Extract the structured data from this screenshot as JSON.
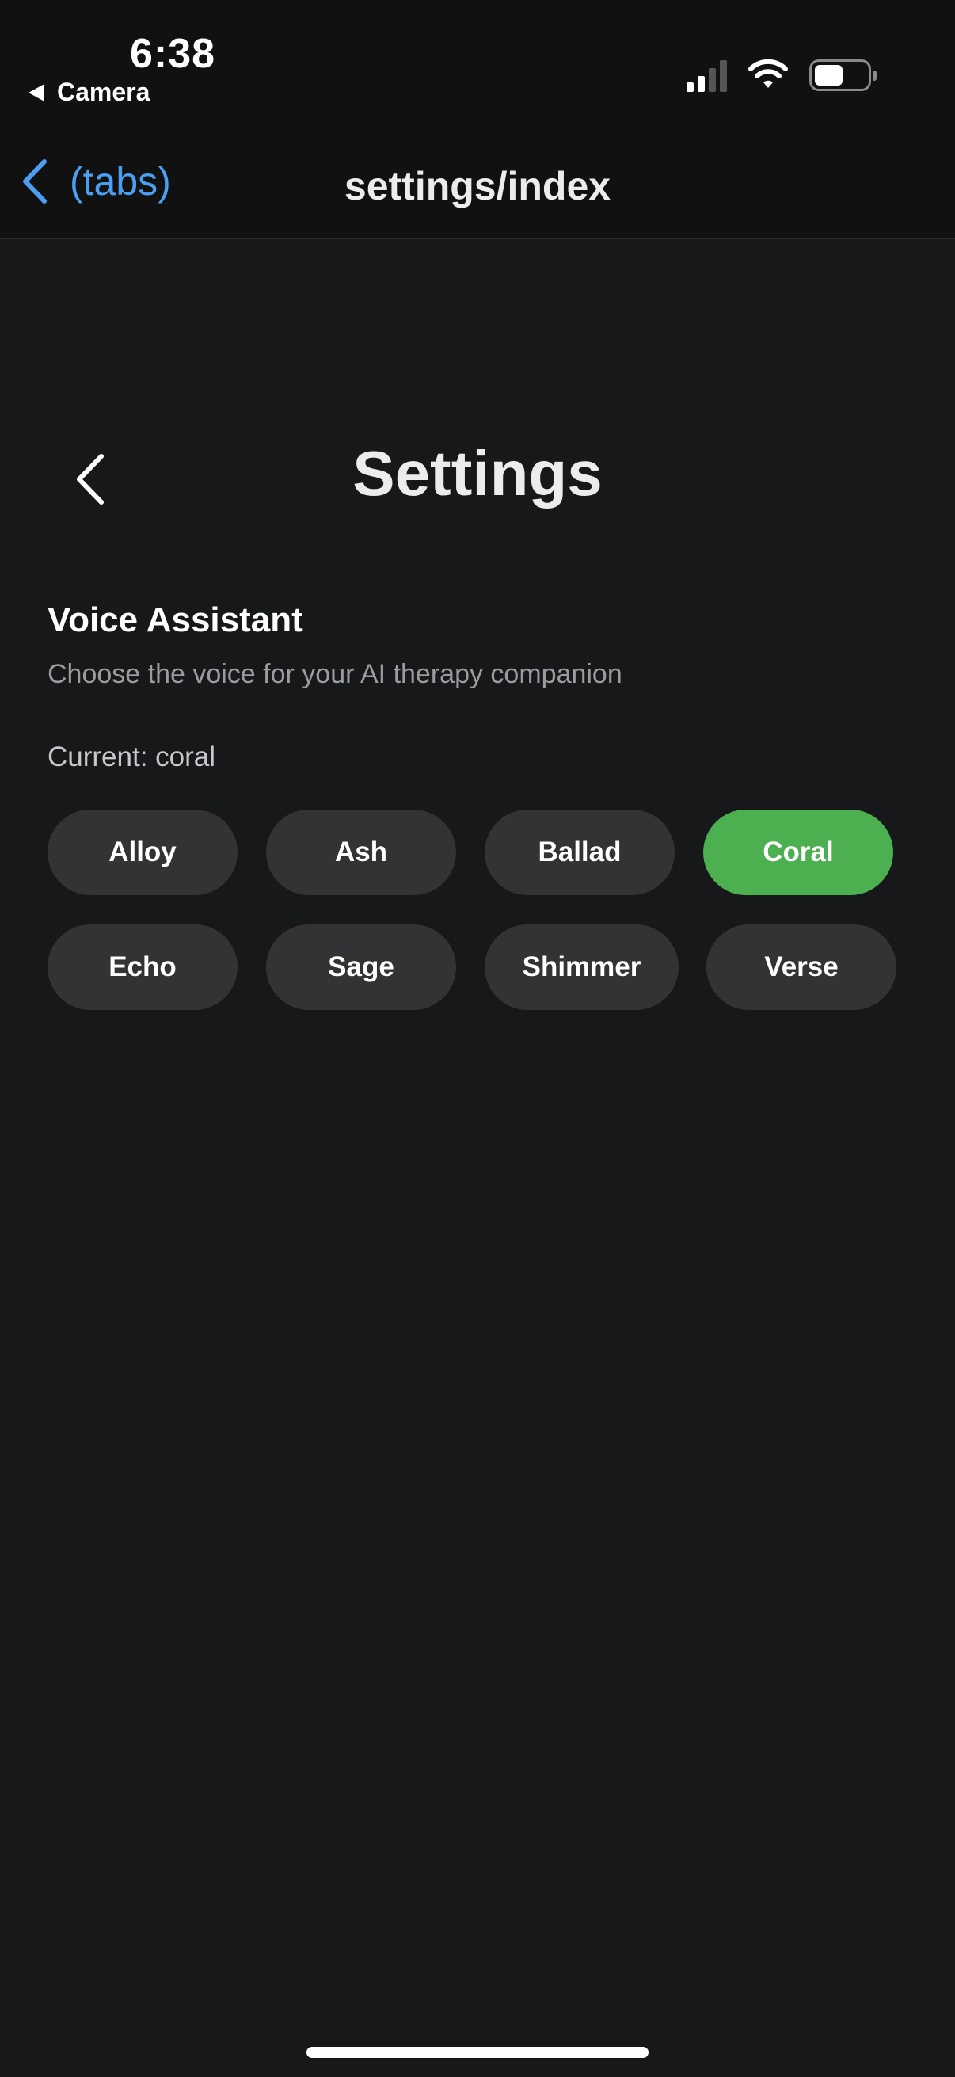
{
  "status_bar": {
    "time": "6:38",
    "back_app_label": "Camera"
  },
  "nav_header": {
    "back_label": "(tabs)",
    "title": "settings/index",
    "accent_color": "#4a9ff0"
  },
  "page": {
    "title": "Settings"
  },
  "voice_section": {
    "title": "Voice Assistant",
    "description": "Choose the voice for your AI therapy companion",
    "current_label": "Current: coral",
    "selected_color": "#4caf50",
    "options": [
      {
        "label": "Alloy",
        "selected": false
      },
      {
        "label": "Ash",
        "selected": false
      },
      {
        "label": "Ballad",
        "selected": false
      },
      {
        "label": "Coral",
        "selected": true
      },
      {
        "label": "Echo",
        "selected": false
      },
      {
        "label": "Sage",
        "selected": false
      },
      {
        "label": "Shimmer",
        "selected": false
      },
      {
        "label": "Verse",
        "selected": false
      }
    ]
  }
}
